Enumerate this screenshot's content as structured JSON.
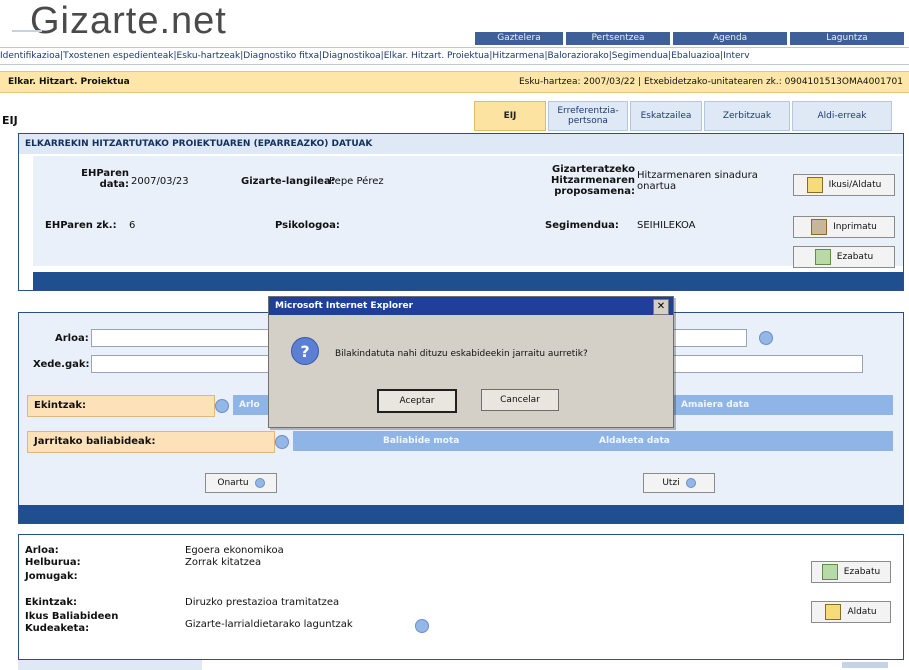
{
  "app": {
    "logo_text": "Gizarte.net"
  },
  "top_menu": [
    {
      "label": "Gaztelera"
    },
    {
      "label": "Pertsentzea"
    },
    {
      "label": "Agenda"
    },
    {
      "label": "Laguntza"
    }
  ],
  "nav": {
    "text": "Identifikazioa|Txostenen espedienteak|Esku-hartzeak|Diagnostiko fitxa|Diagnostikoa|Elkar. Hitzart. Proiektua|Hitzarmena|Baloraziorako|Segimendua|Ebaluazioa|Interv"
  },
  "crumb": {
    "left": "Elkar. Hitzart. Proiektua",
    "right": "Esku-hartzea: 2007/03/22 | Etxebidetzako-unitatearen zk.: 0904101513OMA4001701"
  },
  "tabs": [
    {
      "label": "EIJ"
    },
    {
      "label": "Erreferentzia-pertsona"
    },
    {
      "label": "Eskatzailea"
    },
    {
      "label": "Zerbitzuak"
    },
    {
      "label": "Aldi-erreak"
    }
  ],
  "page_label": "EIJ",
  "panel1": {
    "title": "ELKARREKIN HITZARTUTAKO PROIEKTUAREN (EPARREAZKO) DATUAK",
    "ehp_date_label": "EHParen data:",
    "ehp_date_value": "2007/03/23",
    "worker_label": "Gizarte-langilea:",
    "worker_value": "Pepe Pérez",
    "proposal_label": "Gizarteratzeko Hitzarmenaren proposamena:",
    "proposal_value": "Hitzarmenaren sinadura onartua",
    "ehp_num_label": "EHParen zk.:",
    "ehp_num_value": "6",
    "psych_label": "Psikologoa:",
    "psych_value": "",
    "followup_label": "Segimendua:",
    "followup_value": "SEIHILEKOA",
    "buttons": [
      {
        "label": "Ikusi/Aldatu"
      },
      {
        "label": "Inprimatu"
      },
      {
        "label": "Ezabatu"
      }
    ]
  },
  "panel2": {
    "area_label": "Arloa:",
    "goals_label": "Xede.gak:",
    "actions_label": "Ekintzak:",
    "actions_strip_left": "Arlo",
    "actions_strip_right": "Amaiera data",
    "resources_label": "Jarritako baliabideak:",
    "resources_col1": "Baliabide mota",
    "resources_col2": "Aldaketa data",
    "create_btn": "Onartu",
    "cancel_btn": "Utzi"
  },
  "bottom": {
    "rows": [
      {
        "label": "Arloa:",
        "value": "Egoera ekonomikoa"
      },
      {
        "label": "Helburua:",
        "value": "Zorrak kitatzea"
      },
      {
        "label": "Jomugak:",
        "value": ""
      },
      {
        "label": "Ekintzak:",
        "value": "Diruzko prestazioa tramitatzea"
      },
      {
        "label": "Ikus Baliabideen Kudeaketa:",
        "value": "Gizarte-larrialdietarako laguntzak"
      }
    ],
    "delete_btn": "Ezabatu",
    "edit_btn": "Aldatu"
  },
  "dialog": {
    "title": "Microsoft Internet Explorer",
    "message": "Bilakindatuta nahi dituzu eskabideekin jarraitu aurretik?",
    "ok": "Aceptar",
    "cancel": "Cancelar"
  },
  "colors": {
    "brand_blue": "#1f4f8f",
    "accent_orange": "#fde1b8",
    "dialog_gray": "#d4d0c8"
  }
}
